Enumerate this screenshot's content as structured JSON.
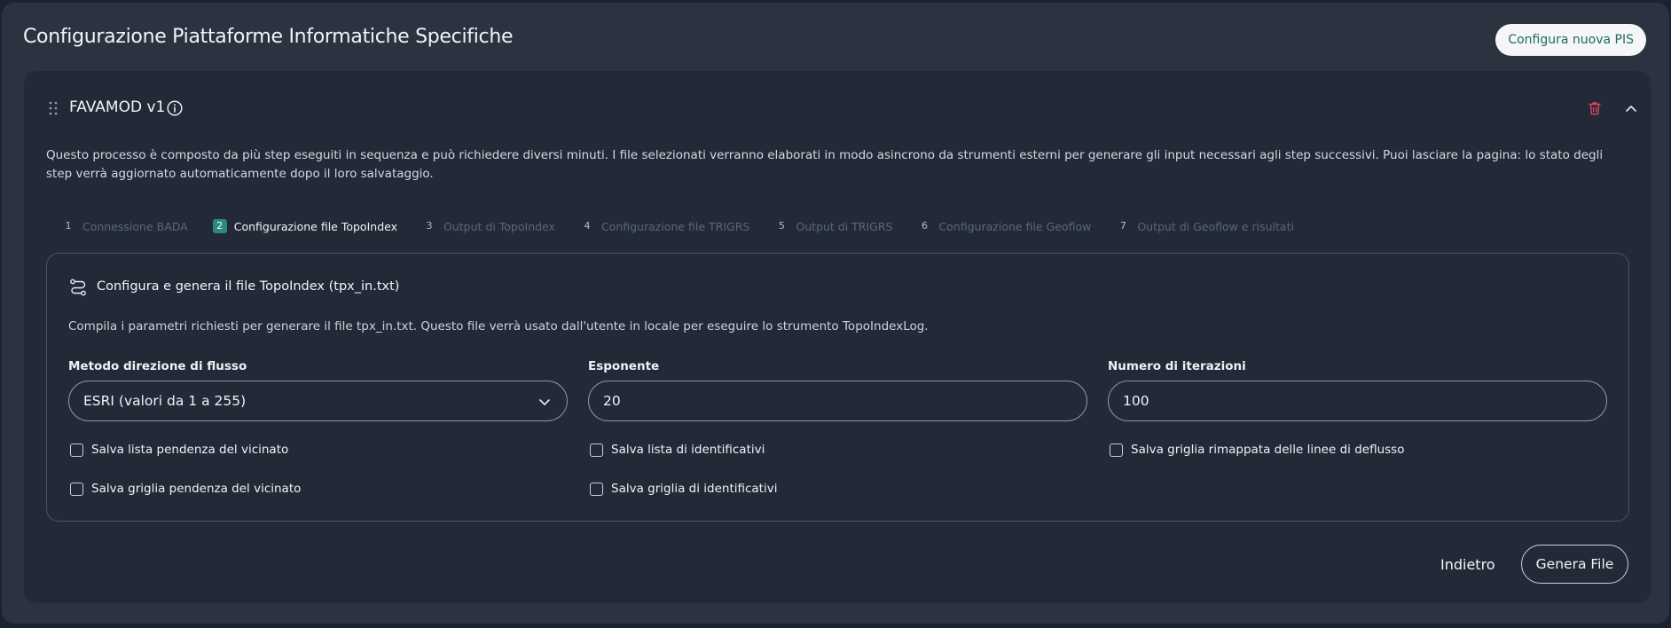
{
  "page": {
    "title": "Configurazione Piattaforme Informatiche Specifiche",
    "new_button": "Configura nuova PIS"
  },
  "card": {
    "title": "FAVAMOD v1",
    "description": "Questo processo è composto da più step eseguiti in sequenza e può richiedere diversi minuti. I file selezionati verranno elaborati in modo asincrono da strumenti esterni per generare gli input necessari agli step successivi. Puoi lasciare la pagina: lo stato degli step verrà aggiornato automaticamente dopo il loro salvataggio.",
    "steps": [
      {
        "num": "1",
        "label": "Connessione BADA"
      },
      {
        "num": "2",
        "label": "Configurazione file TopoIndex"
      },
      {
        "num": "3",
        "label": "Output di TopoIndex"
      },
      {
        "num": "4",
        "label": "Configurazione file TRIGRS"
      },
      {
        "num": "5",
        "label": "Output di TRIGRS"
      },
      {
        "num": "6",
        "label": "Configurazione file Geoflow"
      },
      {
        "num": "7",
        "label": "Output di Geoflow e risultati"
      }
    ],
    "active_step": "2"
  },
  "form": {
    "title": "Configura e genera il file TopoIndex (tpx_in.txt)",
    "description": "Compila i parametri richiesti per generare il file tpx_in.txt. Questo file verrà usato dall'utente in locale per eseguire lo strumento TopoIndexLog.",
    "method_label": "Metodo direzione di flusso",
    "method_value": "ESRI (valori da 1 a 255)",
    "exponent_label": "Esponente",
    "exponent_value": "20",
    "iterations_label": "Numero di iterazioni",
    "iterations_value": "100",
    "checkboxes": [
      "Salva lista pendenza del vicinato",
      "Salva lista di identificativi",
      "Salva griglia rimappata delle linee di deflusso",
      "Salva griglia pendenza del vicinato",
      "Salva griglia di identificativi"
    ]
  },
  "actions": {
    "back": "Indietro",
    "generate": "Genera File"
  },
  "colors": {
    "accent": "#2b8a7c",
    "danger": "#e0455b",
    "background": "#2b3341",
    "card": "#222a37"
  }
}
